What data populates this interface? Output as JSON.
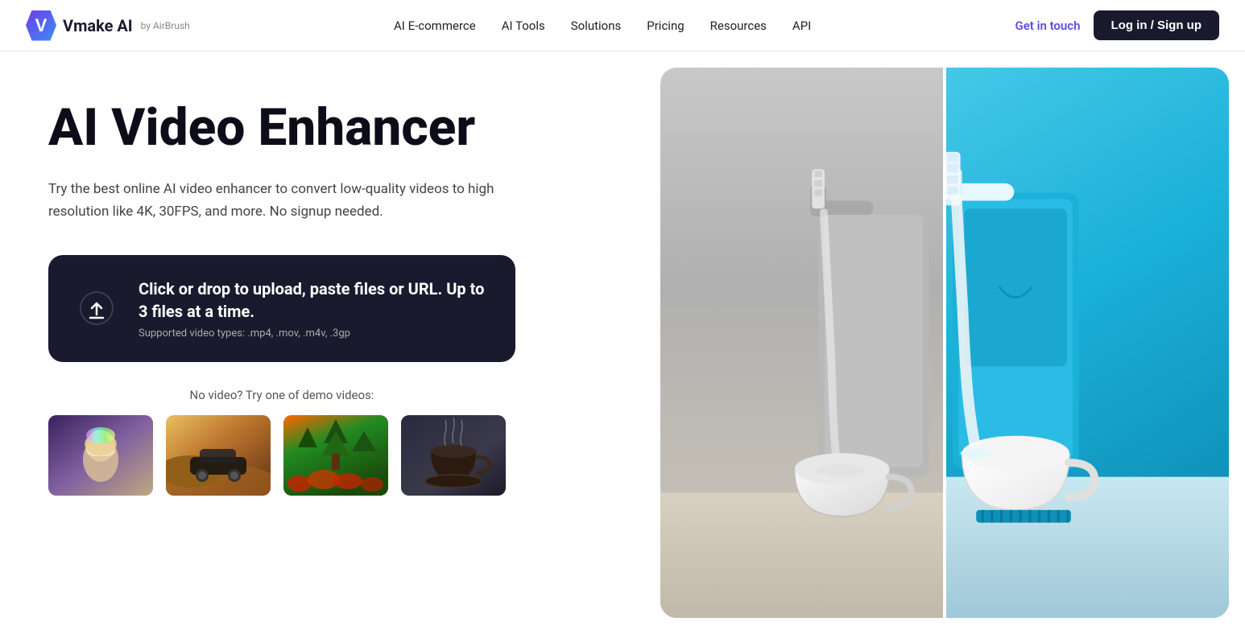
{
  "brand": {
    "logo_letter": "V",
    "name": "Vmake AI",
    "sub": "by AirBrush"
  },
  "nav": {
    "links": [
      {
        "label": "AI E-commerce",
        "id": "ai-ecommerce"
      },
      {
        "label": "AI Tools",
        "id": "ai-tools"
      },
      {
        "label": "Solutions",
        "id": "solutions"
      },
      {
        "label": "Pricing",
        "id": "pricing"
      },
      {
        "label": "Resources",
        "id": "resources"
      },
      {
        "label": "API",
        "id": "api"
      }
    ],
    "get_in_touch": "Get in touch",
    "login": "Log in / Sign up"
  },
  "hero": {
    "title": "AI Video Enhancer",
    "subtitle": "Try the best online AI video enhancer to convert low-quality videos to high resolution like 4K, 30FPS, and more. No signup needed.",
    "upload": {
      "main_text": "Click or drop to upload, paste files or URL. Up to 3 files at a time.",
      "sub_text": "Supported video types: .mp4, .mov, .m4v, .3gp"
    },
    "demo_label": "No video? Try one of demo videos:",
    "demo_videos": [
      {
        "id": "demo-1",
        "class": "thumb-1"
      },
      {
        "id": "demo-2",
        "class": "thumb-2"
      },
      {
        "id": "demo-3",
        "class": "thumb-3"
      },
      {
        "id": "demo-4",
        "class": "thumb-4"
      }
    ]
  }
}
